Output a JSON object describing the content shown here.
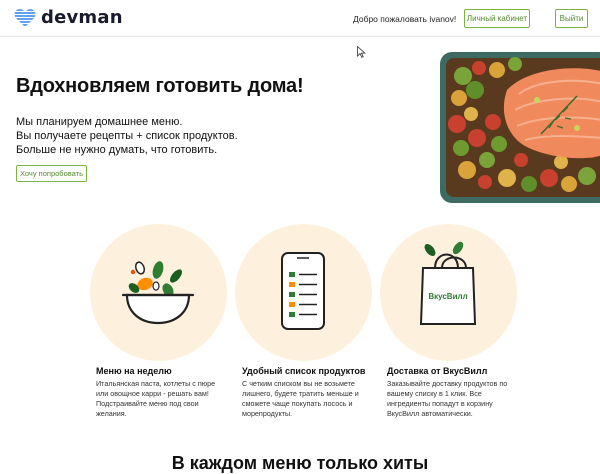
{
  "header": {
    "brand": "devman",
    "welcome": "Добро пожаловать ivanov!",
    "cabinet_label": "Личный кабинет",
    "logout_label": "Выйти"
  },
  "hero": {
    "title": "Вдохновляем готовить дома!",
    "lines": [
      "Мы планируем домашнее меню.",
      "Вы получаете рецепты + список продуктов.",
      "Больше не нужно думать, что готовить."
    ],
    "cta_label": "Хочу попробовать"
  },
  "features": [
    {
      "icon": "salad-bowl-icon",
      "title": "Меню на неделю",
      "desc": "Итальянская паста, котлеты с пюре или овощное карри - решать вам! Подстраивайте меню под свои желания."
    },
    {
      "icon": "phone-list-icon",
      "title": "Удобный список продуктов",
      "desc": "С четким списком вы не возьмете лишнего, будете тратить меньше и сможете чаще покупать лосось и морепродукты."
    },
    {
      "icon": "shopping-bag-icon",
      "title": "Доставка от ВкусВилл",
      "desc": "Заказывайте доставку продуктов по вашему списку в 1 клик. Все ингредиенты попадут в корзину ВкусВилл автоматически.",
      "bag_label": "ВкусВилл"
    }
  ],
  "section": {
    "title": "В каждом меню только хиты"
  },
  "colors": {
    "accent": "#7cb342",
    "circle_bg": "#fdf1dd",
    "logo_blue": "#2f80ed"
  }
}
